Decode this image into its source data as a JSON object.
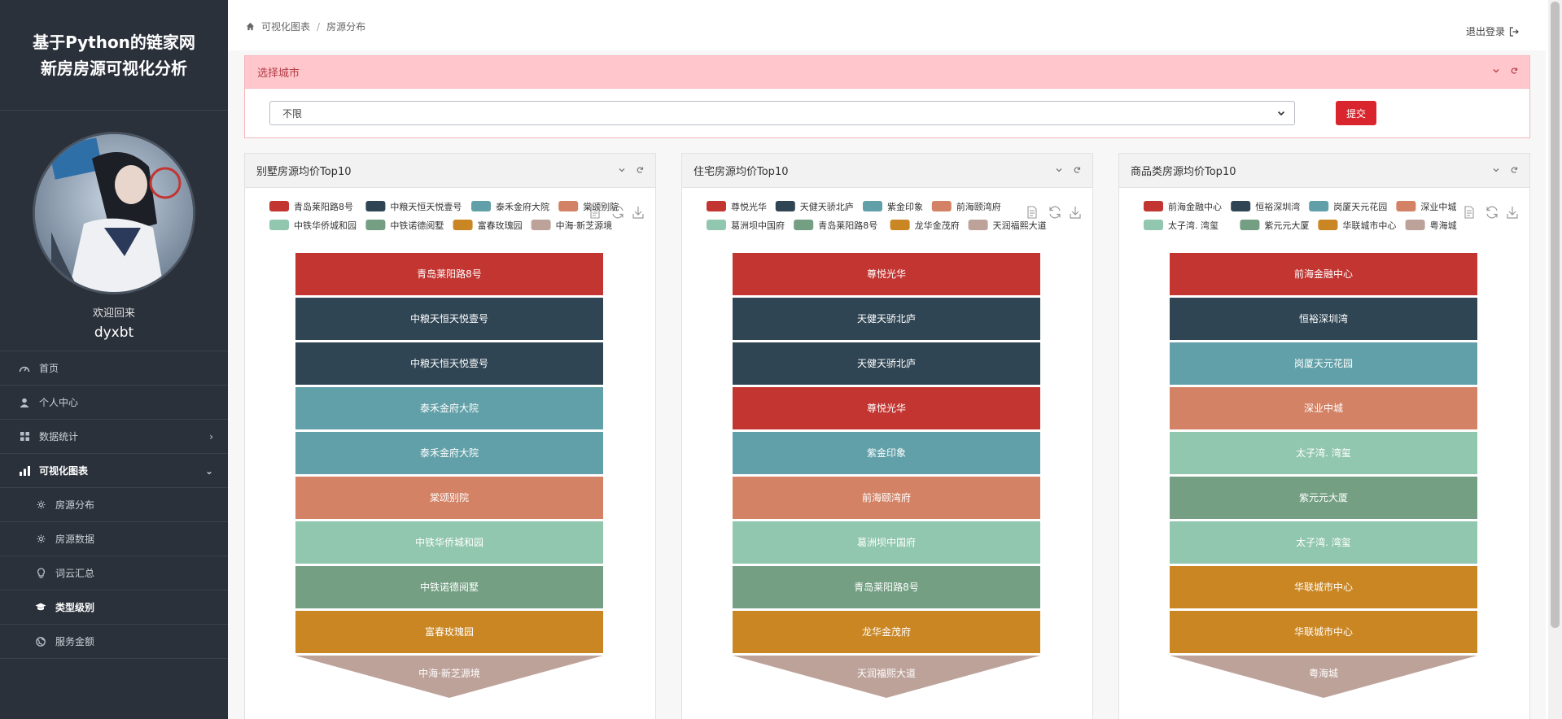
{
  "app": {
    "title_line1": "基于Python的链家网",
    "title_line2": "新房房源可视化分析"
  },
  "profile": {
    "welcome": "欢迎回来",
    "username": "dyxbt"
  },
  "nav": [
    {
      "label": "首页",
      "icon": "dashboard-icon",
      "sub": false,
      "active": false
    },
    {
      "label": "个人中心",
      "icon": "user-icon",
      "sub": false,
      "active": false
    },
    {
      "label": "数据统计",
      "icon": "grid-icon",
      "sub": false,
      "active": false,
      "chevron": "›"
    },
    {
      "label": "可视化图表",
      "icon": "bar-chart-icon",
      "sub": false,
      "active": true,
      "chevron": "⌄"
    },
    {
      "label": "房源分布",
      "icon": "gear-icon",
      "sub": true,
      "active": false
    },
    {
      "label": "房源数据",
      "icon": "gear-icon",
      "sub": true,
      "active": false
    },
    {
      "label": "词云汇总",
      "icon": "lightbulb-icon",
      "sub": true,
      "active": false
    },
    {
      "label": "类型级别",
      "icon": "graduation-cap-icon",
      "sub": true,
      "active": true
    },
    {
      "label": "服务金额",
      "icon": "globe-icon",
      "sub": true,
      "active": false
    }
  ],
  "breadcrumb": {
    "home": "可视化图表",
    "current": "房源分布"
  },
  "header": {
    "logout": "退出登录"
  },
  "city_filter": {
    "title": "选择城市",
    "selected": "不限",
    "submit": "提交"
  },
  "colors": [
    "#c23531",
    "#2f4554",
    "#61a0a8",
    "#d48265",
    "#91c7ae",
    "#749f83",
    "#ca8622",
    "#bda29a"
  ],
  "charts": [
    {
      "title": "别墅房源均价Top10"
    },
    {
      "title": "住宅房源均价Top10"
    },
    {
      "title": "商品类房源均价Top10"
    }
  ],
  "chart_data": [
    {
      "type": "funnel",
      "title": "别墅房源均价Top10",
      "legend": [
        "青岛莱阳路8号",
        "中粮天恒天悦壹号",
        "泰禾金府大院",
        "棠颂别院",
        "中铁华侨城和园",
        "中铁诺德阅墅",
        "富春玫瑰园",
        "中海·新芝源境"
      ],
      "stages": [
        {
          "label": "青岛莱阳路8号",
          "color_index": 0
        },
        {
          "label": "中粮天恒天悦壹号",
          "color_index": 1
        },
        {
          "label": "中粮天恒天悦壹号",
          "color_index": 1
        },
        {
          "label": "泰禾金府大院",
          "color_index": 2
        },
        {
          "label": "泰禾金府大院",
          "color_index": 2
        },
        {
          "label": "棠颂别院",
          "color_index": 3
        },
        {
          "label": "中铁华侨城和园",
          "color_index": 4
        },
        {
          "label": "中铁诺德阅墅",
          "color_index": 5
        },
        {
          "label": "富春玫瑰园",
          "color_index": 6
        },
        {
          "label": "中海·新芝源境",
          "color_index": 7
        }
      ]
    },
    {
      "type": "funnel",
      "title": "住宅房源均价Top10",
      "legend": [
        "尊悦光华",
        "天健天骄北庐",
        "紫金印象",
        "前海颐湾府",
        "葛洲坝中国府",
        "青岛莱阳路8号",
        "龙华金茂府",
        "天润福熙大道"
      ],
      "stages": [
        {
          "label": "尊悦光华",
          "color_index": 0
        },
        {
          "label": "天健天骄北庐",
          "color_index": 1
        },
        {
          "label": "天健天骄北庐",
          "color_index": 1
        },
        {
          "label": "尊悦光华",
          "color_index": 0
        },
        {
          "label": "紫金印象",
          "color_index": 2
        },
        {
          "label": "前海颐湾府",
          "color_index": 3
        },
        {
          "label": "葛洲坝中国府",
          "color_index": 4
        },
        {
          "label": "青岛莱阳路8号",
          "color_index": 5
        },
        {
          "label": "龙华金茂府",
          "color_index": 6
        },
        {
          "label": "天润福熙大道",
          "color_index": 7
        }
      ]
    },
    {
      "type": "funnel",
      "title": "商品类房源均价Top10",
      "legend": [
        "前海金融中心",
        "恒裕深圳湾",
        "岗厦天元花园",
        "深业中城",
        "太子湾. 湾玺",
        "紫元元大厦",
        "华联城市中心",
        "粤海城"
      ],
      "stages": [
        {
          "label": "前海金融中心",
          "color_index": 0
        },
        {
          "label": "恒裕深圳湾",
          "color_index": 1
        },
        {
          "label": "岗厦天元花园",
          "color_index": 2
        },
        {
          "label": "深业中城",
          "color_index": 3
        },
        {
          "label": "太子湾. 湾玺",
          "color_index": 4
        },
        {
          "label": "紫元元大厦",
          "color_index": 5
        },
        {
          "label": "太子湾. 湾玺",
          "color_index": 4
        },
        {
          "label": "华联城市中心",
          "color_index": 6
        },
        {
          "label": "华联城市中心",
          "color_index": 6
        },
        {
          "label": "粤海城",
          "color_index": 7
        }
      ]
    }
  ]
}
